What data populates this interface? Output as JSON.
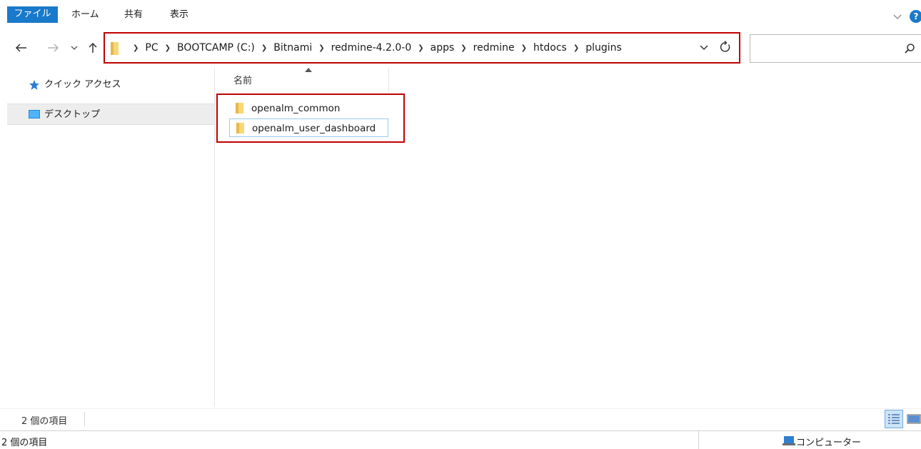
{
  "ribbon": {
    "tabs": [
      "ファイル",
      "ホーム",
      "共有",
      "表示"
    ],
    "help_glyph": "?"
  },
  "address_bar": {
    "crumbs": [
      "PC",
      "BOOTCAMP (C:)",
      "Bitnami",
      "redmine-4.2.0-0",
      "apps",
      "redmine",
      "htdocs",
      "plugins"
    ],
    "separator_glyph": "❯"
  },
  "search": {
    "placeholder": ""
  },
  "sidebar": {
    "items": [
      {
        "label": "クイック アクセス",
        "icon": "star-icon"
      },
      {
        "label": "デスクトップ",
        "icon": "desktop-icon"
      }
    ]
  },
  "content": {
    "column_header": "名前",
    "files": [
      {
        "name": "openalm_common",
        "icon": "folder-icon"
      },
      {
        "name": "openalm_user_dashboard",
        "icon": "folder-icon"
      }
    ]
  },
  "status": {
    "item_count": "2 個の項目",
    "outer_item_count": "2 個の項目",
    "computer_label": "コンピューター"
  },
  "colors": {
    "accent": "#1979ca",
    "highlight_border": "#c00000",
    "folder": "#f8d775",
    "selection": "#cce4f7"
  }
}
